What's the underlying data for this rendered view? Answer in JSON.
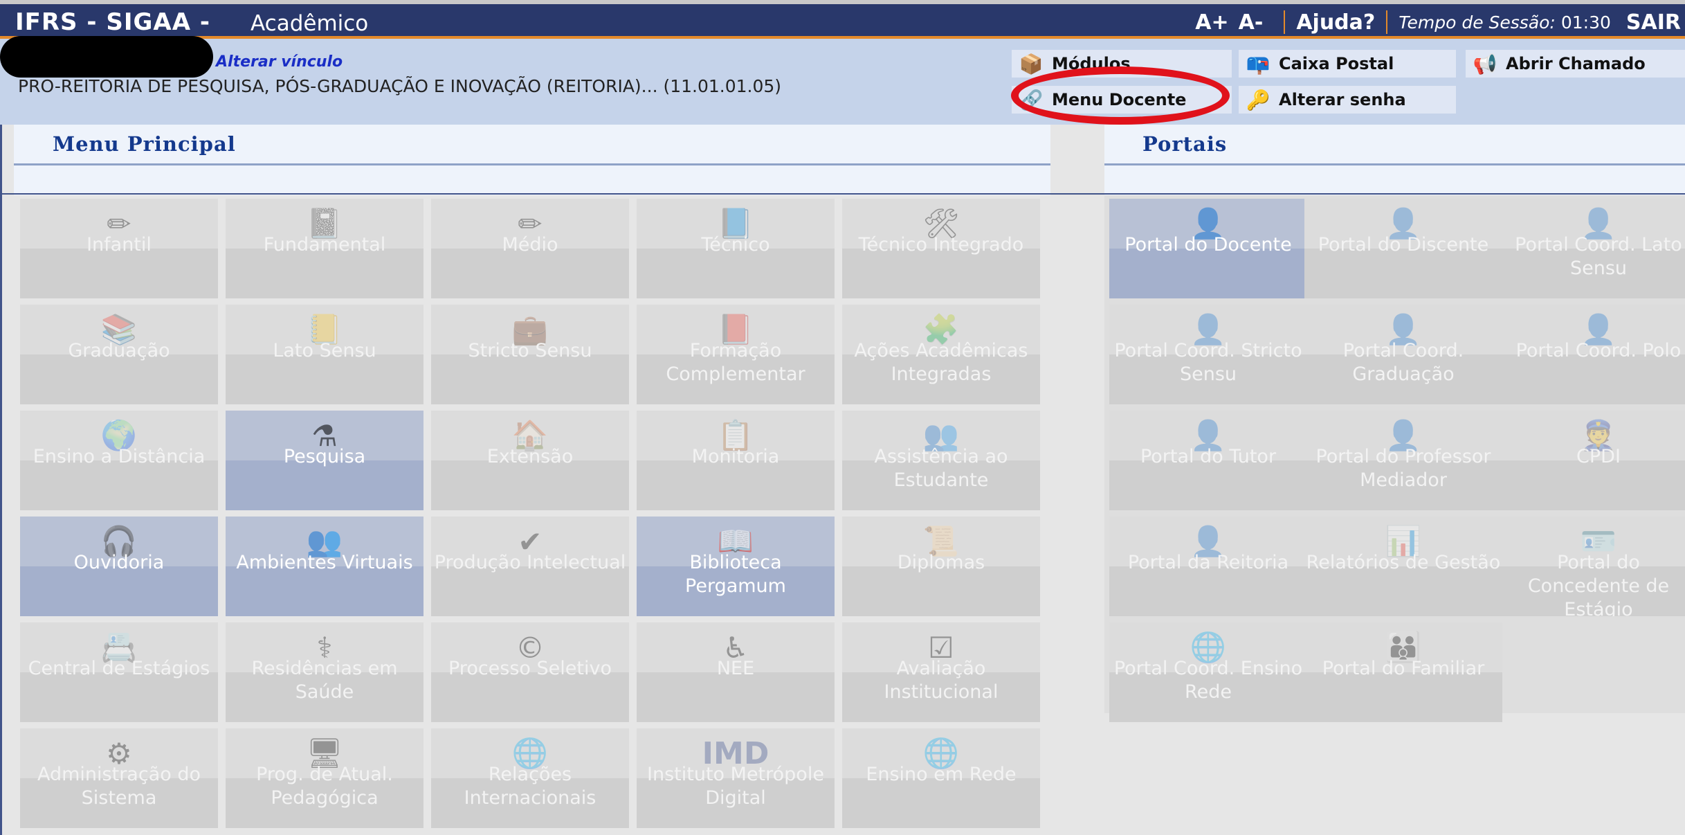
{
  "header": {
    "system": "IFRS - SIGAA -",
    "module": "Acadêmico",
    "font_increase": "A+",
    "font_decrease": "A-",
    "help": "Ajuda?",
    "session_label": "Tempo de Sessão:",
    "session_time": "01:30",
    "exit": "SAIR"
  },
  "user": {
    "change_link": "Alterar vínculo",
    "unit": "PRO-REITORIA DE PESQUISA, PÓS-GRADUAÇÃO E INOVAÇÃO (REITORIA)... (11.01.01.05)"
  },
  "quick_links": {
    "modulos": "Módulos",
    "caixa_postal": "Caixa Postal",
    "abrir_chamado": "Abrir Chamado",
    "menu_docente": "Menu Docente",
    "alterar_senha": "Alterar senha"
  },
  "colors": {
    "header_bg": "#29386b",
    "accent_orange": "#e48a2a",
    "highlight_red": "#e0121b"
  },
  "main_menu": {
    "title": "Menu Principal",
    "items": [
      {
        "label": "Infantil",
        "icon": "pencils-icon"
      },
      {
        "label": "Fundamental",
        "icon": "notebook-icon"
      },
      {
        "label": "Médio",
        "icon": "pencil-icon"
      },
      {
        "label": "Técnico",
        "icon": "blue-book-icon"
      },
      {
        "label": "Técnico Integrado",
        "icon": "tools-icon"
      },
      {
        "label": "Graduação",
        "icon": "books-stack-icon"
      },
      {
        "label": "Lato Sensu",
        "icon": "folder-book-icon"
      },
      {
        "label": "Stricto Sensu",
        "icon": "briefcase-icon"
      },
      {
        "label": "Formação Complementar",
        "icon": "red-book-icon"
      },
      {
        "label": "Ações Acadêmicas Integradas",
        "icon": "puzzle-icon"
      },
      {
        "label": "Ensino a Distância",
        "icon": "globe-icon"
      },
      {
        "label": "Pesquisa",
        "icon": "flask-icon"
      },
      {
        "label": "Extensão",
        "icon": "house-icon"
      },
      {
        "label": "Monitoria",
        "icon": "presentation-board-icon"
      },
      {
        "label": "Assistência ao Estudante",
        "icon": "people-icon"
      },
      {
        "label": "Ouvidoria",
        "icon": "headset-person-icon"
      },
      {
        "label": "Ambientes Virtuais",
        "icon": "network-people-icon"
      },
      {
        "label": "Produção Intelectual",
        "icon": "person-check-icon"
      },
      {
        "label": "Biblioteca Pergamum",
        "icon": "library-book-icon"
      },
      {
        "label": "Diplomas",
        "icon": "diploma-icon"
      },
      {
        "label": "Central de Estágios",
        "icon": "address-book-icon"
      },
      {
        "label": "Residências em Saúde",
        "icon": "doctor-icon"
      },
      {
        "label": "Processo Seletivo",
        "icon": "selection-logo-icon"
      },
      {
        "label": "NEE",
        "icon": "wheelchair-icon"
      },
      {
        "label": "Avaliação Institucional",
        "icon": "checklist-icon"
      },
      {
        "label": "Administração do Sistema",
        "icon": "gear-icon"
      },
      {
        "label": "Prog. de Atual. Pedagógica",
        "icon": "monitor-icon"
      },
      {
        "label": "Relações Internacionais",
        "icon": "globe-card-icon"
      },
      {
        "label": "Instituto Metrópole Digital",
        "icon": "imd-logo-icon",
        "icon_text": "IMD"
      },
      {
        "label": "Ensino em Rede",
        "icon": "network-map-icon"
      }
    ]
  },
  "portals": {
    "title": "Portais",
    "items": [
      {
        "label": "Portal do Docente",
        "icon": "person-icon"
      },
      {
        "label": "Portal do Discente",
        "icon": "person-icon"
      },
      {
        "label": "Portal Coord. Lato Sensu",
        "icon": "person-icon"
      },
      {
        "label": "Portal Coord. Stricto Sensu",
        "icon": "person-icon"
      },
      {
        "label": "Portal Coord. Graduação",
        "icon": "person-icon"
      },
      {
        "label": "Portal Coord. Polo",
        "icon": "person-icon"
      },
      {
        "label": "Portal do Tutor",
        "icon": "person-icon"
      },
      {
        "label": "Portal do Professor Mediador",
        "icon": "person-icon"
      },
      {
        "label": "CPDI",
        "icon": "officer-icon"
      },
      {
        "label": "Portal da Reitoria",
        "icon": "suit-person-icon"
      },
      {
        "label": "Relatórios de Gestão",
        "icon": "reports-icon"
      },
      {
        "label": "Portal do Concedente de Estágio",
        "icon": "id-card-icon"
      },
      {
        "label": "Portal Coord. Ensino Rede",
        "icon": "network-map-icon"
      },
      {
        "label": "Portal do Familiar",
        "icon": "family-icon"
      }
    ]
  }
}
